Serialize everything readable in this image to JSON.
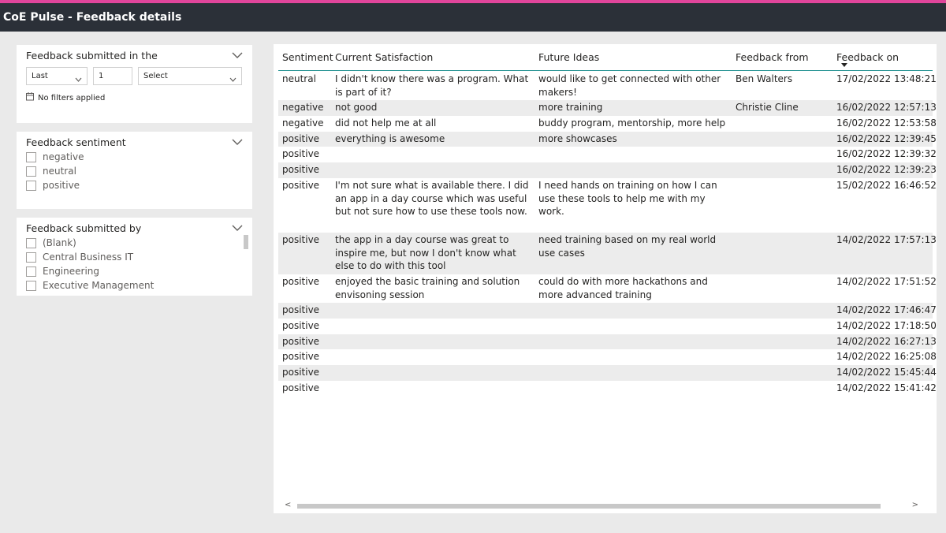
{
  "app": {
    "title": "CoE Pulse - Feedback details",
    "accent_color": "#e0459b",
    "titlebar_color": "#2b3038"
  },
  "slicers": {
    "submitted_in": {
      "header": "Feedback submitted in the",
      "mode": "Last",
      "count": "1",
      "unit": "Select",
      "status": "No filters applied"
    },
    "sentiment": {
      "header": "Feedback sentiment",
      "options": [
        "negative",
        "neutral",
        "positive"
      ]
    },
    "submitted_by": {
      "header": "Feedback submitted by",
      "options": [
        "(Blank)",
        "Central Business IT",
        "Engineering",
        "Executive Management"
      ]
    }
  },
  "table": {
    "columns": [
      "Sentiment",
      "Current Satisfaction",
      "Future Ideas",
      "Feedback from",
      "Feedback on"
    ],
    "rows": [
      {
        "sentiment": "neutral",
        "current": "I didn't know there was a program. What is part of it?",
        "future": "would like to get connected with other makers!",
        "from": "Ben Walters",
        "on": "17/02/2022 13:48:21"
      },
      {
        "sentiment": "negative",
        "current": "not good",
        "future": "more training",
        "from": "Christie Cline",
        "on": "16/02/2022 12:57:13"
      },
      {
        "sentiment": "negative",
        "current": "did not help me at all",
        "future": "buddy program, mentorship, more help",
        "from": "",
        "on": "16/02/2022 12:53:58"
      },
      {
        "sentiment": "positive",
        "current": "everything is awesome",
        "future": "more showcases",
        "from": "",
        "on": "16/02/2022 12:39:45"
      },
      {
        "sentiment": "positive",
        "current": "",
        "future": "",
        "from": "",
        "on": "16/02/2022 12:39:32"
      },
      {
        "sentiment": "positive",
        "current": "",
        "future": "",
        "from": "",
        "on": "16/02/2022 12:39:23"
      },
      {
        "sentiment": "positive",
        "current": "I'm not sure what is available there. I did an app in a day course which was useful but not sure how to use these tools now.",
        "future": "I need hands on training on how I can use these tools to help me with my work.",
        "from": "",
        "on": "15/02/2022 16:46:52"
      },
      {
        "sentiment": "positive",
        "current": "the app in a day course was great to inspire me, but now I don't know what else to do with this tool",
        "future": "need training based on my real world use cases",
        "from": "",
        "on": "14/02/2022 17:57:13"
      },
      {
        "sentiment": "positive",
        "current": "enjoyed the basic training and solution envisoning session",
        "future": "could do with more hackathons and more advanced training",
        "from": "",
        "on": "14/02/2022 17:51:52"
      },
      {
        "sentiment": "positive",
        "current": "",
        "future": "",
        "from": "",
        "on": "14/02/2022 17:46:47"
      },
      {
        "sentiment": "positive",
        "current": "",
        "future": "",
        "from": "",
        "on": "14/02/2022 17:18:50"
      },
      {
        "sentiment": "positive",
        "current": "",
        "future": "",
        "from": "",
        "on": "14/02/2022 16:27:13"
      },
      {
        "sentiment": "positive",
        "current": "",
        "future": "",
        "from": "",
        "on": "14/02/2022 16:25:08"
      },
      {
        "sentiment": "positive",
        "current": "",
        "future": "",
        "from": "",
        "on": "14/02/2022 15:45:44"
      },
      {
        "sentiment": "positive",
        "current": "",
        "future": "",
        "from": "",
        "on": "14/02/2022 15:41:42"
      }
    ],
    "sort_column": "Feedback on",
    "sort_direction": "descending"
  }
}
